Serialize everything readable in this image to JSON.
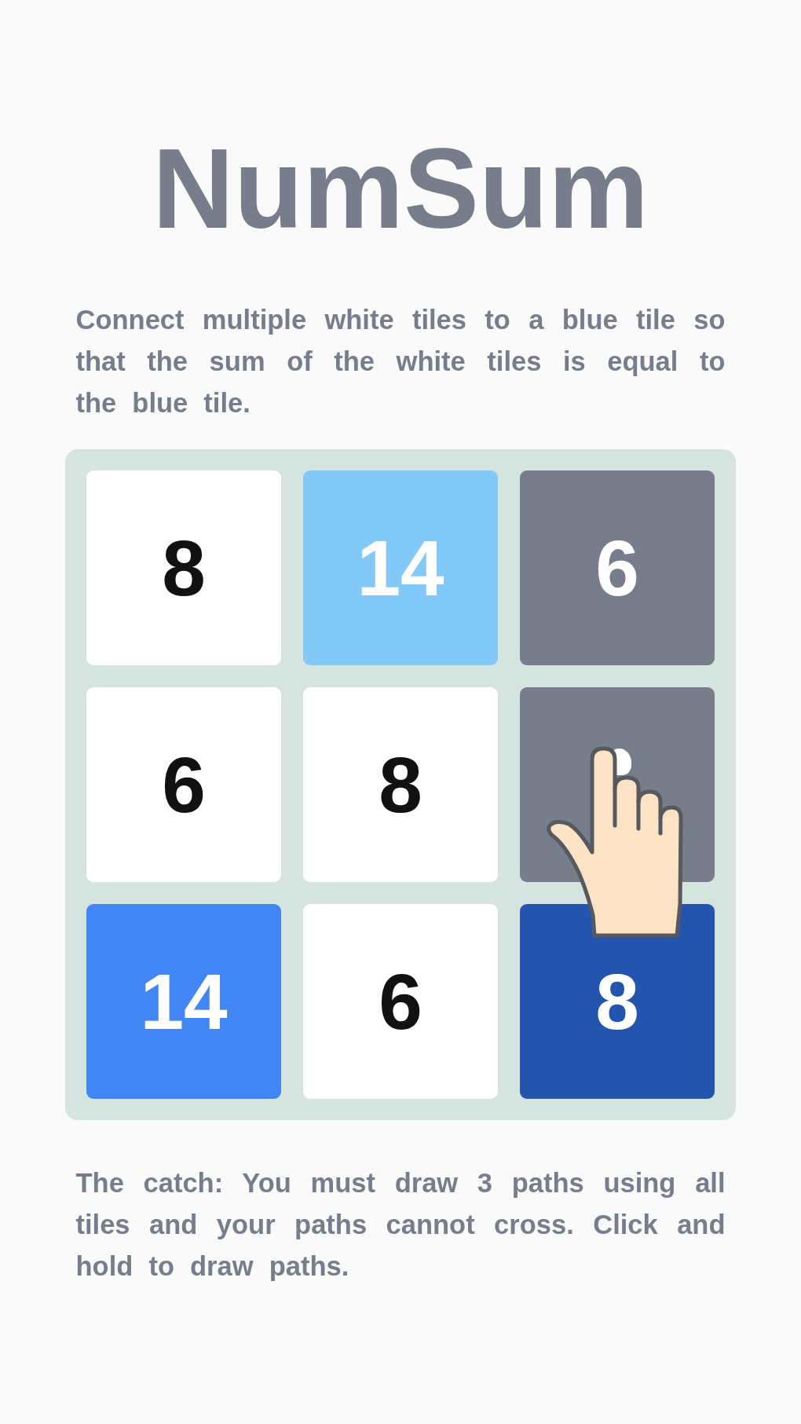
{
  "title": "NumSum",
  "intro": "Connect multiple white tiles to a blue tile so that the sum of the white tiles is equal to the blue tile.",
  "board": {
    "tiles": [
      {
        "value": "8",
        "color": "#ffffff"
      },
      {
        "value": "14",
        "color": "#82c9f8"
      },
      {
        "value": "6",
        "color": "#777d8b"
      },
      {
        "value": "6",
        "color": "#ffffff"
      },
      {
        "value": "8",
        "color": "#ffffff"
      },
      {
        "color": "#777d8b"
      },
      {
        "value": "14",
        "color": "#4285f4"
      },
      {
        "value": "6",
        "color": "#ffffff"
      },
      {
        "value": "8",
        "color": "#2355ae"
      }
    ]
  },
  "rules": "The catch: You must draw 3 paths using all tiles and your paths cannot cross. Click and hold to draw paths."
}
